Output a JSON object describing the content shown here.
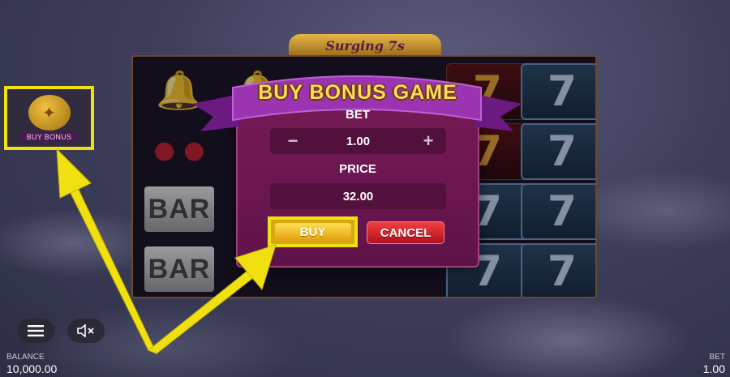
{
  "game": {
    "logo_text": "Surging 7s"
  },
  "side_button": {
    "label": "BUY BONUS",
    "icon": "coin-icon"
  },
  "dialog": {
    "title": "BUY BONUS GAME",
    "bet_label": "BET",
    "bet_value": "1.00",
    "decrease_symbol": "−",
    "increase_symbol": "+",
    "price_label": "PRICE",
    "price_value": "32.00",
    "buy_label": "BUY",
    "cancel_label": "CANCEL"
  },
  "reels": [
    [
      "bell",
      "cherry",
      "bar",
      "bar"
    ],
    [
      "bell",
      "blank",
      "blank",
      "blank"
    ],
    [
      "blank",
      "blank",
      "blank",
      "blank"
    ],
    [
      "blank",
      "blank",
      "blank",
      "blank"
    ],
    [
      "seven-red",
      "seven-red",
      "seven-blue",
      "seven-blue"
    ],
    [
      "seven-blue",
      "seven-blue",
      "seven-blue",
      "seven-blue"
    ]
  ],
  "symbols": {
    "bell": "🔔",
    "cherry": "● ●",
    "bar": "BAR",
    "seven": "7"
  },
  "hud": {
    "balance_label": "BALANCE",
    "balance_value": "10,000.00",
    "bet_label": "BET",
    "bet_value": "1.00",
    "menu_icon": "menu-icon",
    "sound_icon": "sound-muted-icon"
  },
  "colors": {
    "highlight": "#f0e010",
    "dialog_bg": "#751a55",
    "ribbon": "#8a2e9a",
    "title_gold": "#ffd960",
    "cancel_red": "#d82030",
    "buy_gold": "#e0a010"
  }
}
